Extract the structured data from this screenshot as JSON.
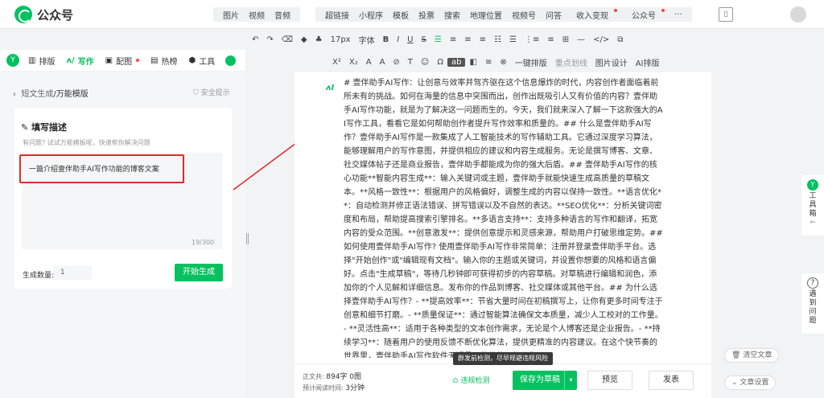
{
  "app": {
    "title": "公众号"
  },
  "topnav": {
    "group1": [
      "图片",
      "视频",
      "音频"
    ],
    "group2": [
      "超链接",
      "小程序",
      "模板",
      "投票",
      "搜索",
      "地理位置",
      "视频号",
      "问答",
      "收入变现",
      "公众号"
    ],
    "more": "···"
  },
  "toolbar": {
    "row1": [
      "↶",
      "↷",
      "⌫",
      "◆",
      "♣",
      "17px",
      "字体",
      "B",
      "I",
      "U",
      "S",
      "☰",
      "≡",
      "≡",
      "≡",
      "☷",
      "☰",
      "⋮≡",
      "≡",
      "⊞",
      "—",
      "</>",
      "⧉"
    ],
    "row2": [
      "X²",
      "X₂",
      "A",
      "A",
      "⊘",
      "T",
      "☺",
      "Ω",
      "ab",
      "◧",
      "≡",
      "⊗"
    ],
    "one_click": "一键排版",
    "highlight": "重点划线",
    "image_design": "图片设计",
    "ai_layout": "AI排版",
    "font_size": "17px",
    "font": "字体"
  },
  "tabs": [
    {
      "label": "排版",
      "icon": "layout-icon"
    },
    {
      "label": "写作",
      "icon": "ai-write-icon"
    },
    {
      "label": "配图",
      "icon": "image-icon"
    },
    {
      "label": "热榜",
      "icon": "hot-icon"
    },
    {
      "label": "工具",
      "icon": "tool-icon"
    }
  ],
  "left": {
    "crumb_parent": "短文生成",
    "crumb_current": "/万能模版",
    "safe": "安全提示",
    "card_title": "填写描述",
    "card_hint": "有问题? 试试万能模板呢，快速帮你解决问题",
    "prompt": "一篇介绍壹伴助手AI写作功能的博客文案",
    "counter": "19/300",
    "qty_label": "生成数量:",
    "qty_value": "1",
    "generate": "开始生成"
  },
  "editor": {
    "ai_badge": "ʌI",
    "article": "# 壹伴助手AI写作：让创意与效率并驾齐驱在这个信息爆炸的时代，内容创作者面临着前所未有的挑战。如何在海量的信息中突围而出，创作出既吸引人又有价值的内容？壹伴助手AI写作功能，就是为了解决这一问题而生的。今天，我们就来深入了解一下这款强大的AI写作工具，看看它是如何帮助创作者提升写作效率和质量的。## 什么是壹伴助手AI写作？壹伴助手AI写作是一款集成了人工智能技术的写作辅助工具。它通过深度学习算法，能够理解用户的写作意图，并提供相应的建议和内容生成服务。无论是撰写博客、文章、社交媒体帖子还是商业报告，壹伴助手都能成为你的强大后盾。## 壹伴助手AI写作的核心功能**智能内容生成**：输入关键词或主题，壹伴助手就能快速生成高质量的草稿文本。**风格一致性**：根据用户的风格偏好，调整生成的内容以保持一致性。**语言优化**：自动检测并修正语法错误、拼写错误以及不自然的表达。**SEO优化**：分析关键词密度和布局，帮助提高搜索引擎排名。**多语言支持**：支持多种语言的写作和翻译，拓宽内容的受众范围。**创意激发**：提供创意提示和灵感来源，帮助用户打破思维定势。## 如何使用壹伴助手AI写作? 使用壹伴助手AI写作非常简单：注册并登录壹伴助手平台。选择\"开始创作\"或\"编辑现有文档\"。输入你的主题或关键词，并设置你想要的风格和语言偏好。点击\"生成草稿\"，等待几秒钟即可获得初步的内容草稿。对草稿进行编辑和润色，添加你的个人见解和详细信息。发布你的作品到博客、社交媒体或其他平台。## 为什么选择壹伴助手AI写作？- **提高效率**：节省大量时间在初稿撰写上，让你有更多时间专注于创意和细节打磨。- **质量保证**：通过智能算法确保文本质量，减少人工校对的工作量。- **灵活性高**：适用于各种类型的文本创作需求，无论是个人博客还是企业报告。- **持续学习**：随着用户的使用反馈不断优化算法，提供更精准的内容建议。在这个快节奏的世界里，壹伴助手AI写作软件无疑是一种优势。如果你",
    "wc_label": "正文共:",
    "wc_value": "894字 0图",
    "read_label": "预计阅读时间:",
    "read_value": "3分钟",
    "check": "违规检测",
    "tooltip": "群发前检测，尽早规避违规风险",
    "save": "保存为草稿",
    "preview": "预览",
    "publish": "发表"
  },
  "right": {
    "toolbox": "工具箱",
    "help": "遇到问题",
    "clear": "清空文章",
    "settings": "文章设置"
  },
  "colors": {
    "accent": "#07c160",
    "highlight": "#e02b2b"
  }
}
